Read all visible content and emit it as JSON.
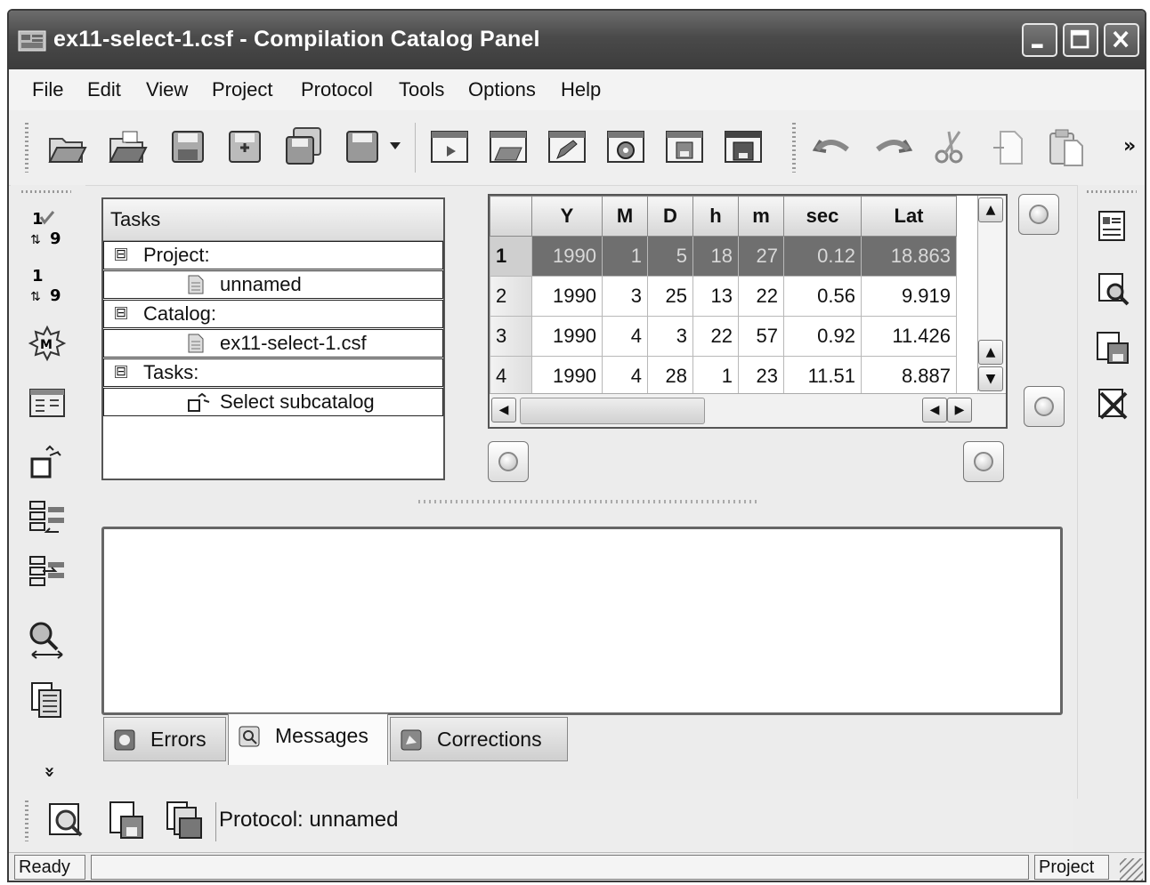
{
  "window": {
    "title": "ex11-select-1.csf - Compilation Catalog Panel",
    "controls": {
      "minimize": "minimize-icon",
      "maximize": "maximize-icon",
      "close": "close-icon"
    }
  },
  "menu": [
    "File",
    "Edit",
    "View",
    "Project",
    "Protocol",
    "Tools",
    "Options",
    "Help"
  ],
  "toolbar": {
    "overflow_label": "»",
    "icons": [
      "open-folder-icon",
      "open-project-icon",
      "save-icon",
      "save-as-icon",
      "save-all-icon",
      "save-dropdown-icon",
      "window-new-icon",
      "window-open-icon",
      "window-edit-icon",
      "window-settings-icon",
      "window-save-icon",
      "window-save-as-icon",
      "undo-icon",
      "redo-icon",
      "cut-icon",
      "copy-icon",
      "paste-icon"
    ]
  },
  "left_toolbar": {
    "icons": [
      "sort-ascending-icon",
      "sort-numbers-icon",
      "magnitude-icon",
      "table-view-icon",
      "select-subcatalog-icon",
      "merge-left-icon",
      "merge-right-icon",
      "search-range-icon",
      "catalog-list-icon"
    ],
    "more_label": "»"
  },
  "right_toolbar": {
    "icons": [
      "report-icon",
      "preview-icon",
      "export-icon",
      "delete-icon"
    ]
  },
  "tasks_panel": {
    "header": "Tasks",
    "tree": [
      {
        "label": "Project:",
        "toggle": "⊟"
      },
      {
        "label": "unnamed",
        "child": true
      },
      {
        "label": "Catalog:",
        "toggle": "⊟"
      },
      {
        "label": "ex11-select-1.csf",
        "child": true
      },
      {
        "label": "Tasks:",
        "toggle": "⊟"
      },
      {
        "label": "Select subcatalog",
        "child": true
      }
    ]
  },
  "table": {
    "columns": [
      "",
      "Y",
      "M",
      "D",
      "h",
      "m",
      "sec",
      "Lat"
    ],
    "rows": [
      [
        "1",
        "1990",
        "1",
        "5",
        "18",
        "27",
        "0.12",
        "18.863"
      ],
      [
        "2",
        "1990",
        "3",
        "25",
        "13",
        "22",
        "0.56",
        "9.919"
      ],
      [
        "3",
        "1990",
        "4",
        "3",
        "22",
        "57",
        "0.92",
        "11.426"
      ],
      [
        "4",
        "1990",
        "4",
        "28",
        "1",
        "23",
        "11.51",
        "8.887"
      ]
    ],
    "selected_row": 0
  },
  "message_tabs": [
    {
      "label": "Errors",
      "icon": "errors-icon"
    },
    {
      "label": "Messages",
      "icon": "messages-icon",
      "active": true
    },
    {
      "label": "Corrections",
      "icon": "corrections-icon"
    }
  ],
  "protocol_bar": {
    "label": "Protocol: unnamed",
    "icons": [
      "protocol-view-icon",
      "protocol-save-icon",
      "protocol-save-as-icon"
    ]
  },
  "status_bar": {
    "left": "Ready",
    "right": "Project"
  }
}
